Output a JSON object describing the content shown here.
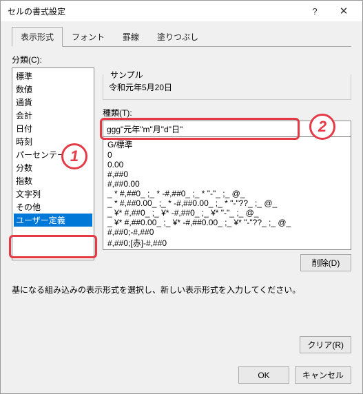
{
  "title": "セルの書式設定",
  "tabs": [
    "表示形式",
    "フォント",
    "罫線",
    "塗りつぶし"
  ],
  "activeTab": 0,
  "category_label": "分類(C):",
  "categories": [
    "標準",
    "数値",
    "通貨",
    "会計",
    "日付",
    "時刻",
    "パーセンテージ",
    "分数",
    "指数",
    "文字列",
    "その他",
    "ユーザー定義"
  ],
  "selected_category_index": 11,
  "sample_label": "サンプル",
  "sample_value": "令和元年5月20日",
  "type_label": "種類(T):",
  "type_value": "ggg\"元年\"m\"月\"d\"日\"",
  "format_list": [
    "G/標準",
    "0",
    "0.00",
    "#,##0",
    "#,##0.00",
    "_ * #,##0_ ;_ * -#,##0_ ;_ * \"-\"_ ;_ @_",
    "_ * #,##0.00_ ;_ * -#,##0.00_ ;_ * \"-\"??_ ;_ @_",
    "_ ¥* #,##0_ ;_ ¥* -#,##0_ ;_ ¥* \"-\"_ ;_ @_",
    "_ ¥* #,##0.00_ ;_ ¥* -#,##0.00_ ;_ ¥* \"-\"??_ ;_ @_",
    "#,##0;-#,##0",
    "#,##0;[赤]-#,##0"
  ],
  "delete_btn": "削除(D)",
  "hint": "基になる組み込みの表示形式を選択し、新しい表示形式を入力してください。",
  "clear_btn": "クリア(R)",
  "ok_btn": "OK",
  "cancel_btn": "キャンセル",
  "annotations": {
    "badge1": "1",
    "badge2": "2"
  }
}
